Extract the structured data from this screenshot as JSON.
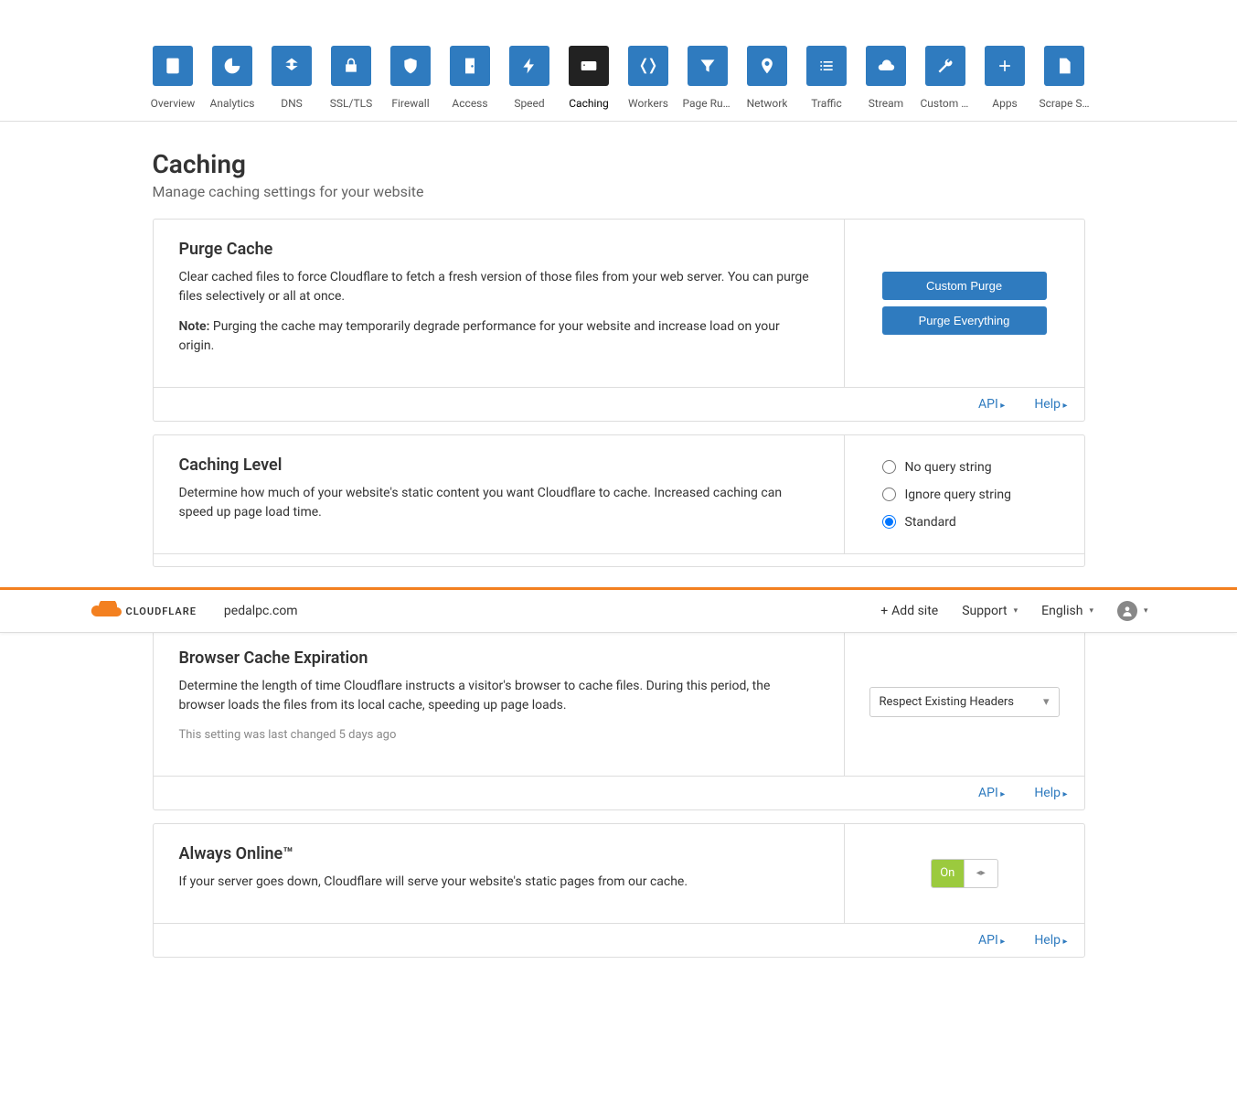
{
  "header": {
    "site_name": "pedalpc.com",
    "add_site": "Add site",
    "support": "Support",
    "language": "English",
    "logo_text": "CLOUDFLARE"
  },
  "nav": {
    "items": [
      {
        "label": "Overview"
      },
      {
        "label": "Analytics"
      },
      {
        "label": "DNS"
      },
      {
        "label": "SSL/TLS"
      },
      {
        "label": "Firewall"
      },
      {
        "label": "Access"
      },
      {
        "label": "Speed"
      },
      {
        "label": "Caching"
      },
      {
        "label": "Workers"
      },
      {
        "label": "Page Rules"
      },
      {
        "label": "Network"
      },
      {
        "label": "Traffic"
      },
      {
        "label": "Stream"
      },
      {
        "label": "Custom P…"
      },
      {
        "label": "Apps"
      },
      {
        "label": "Scrape S…"
      }
    ],
    "active_index": 7
  },
  "page": {
    "title": "Caching",
    "subtitle": "Manage caching settings for your website"
  },
  "cards": {
    "purge": {
      "title": "Purge Cache",
      "desc": "Clear cached files to force Cloudflare to fetch a fresh version of those files from your web server. You can purge files selectively or all at once.",
      "note_prefix": "Note:",
      "note_body": " Purging the cache may temporarily degrade performance for your website and increase load on your origin.",
      "btn_custom": "Custom Purge",
      "btn_everything": "Purge Everything"
    },
    "level": {
      "title": "Caching Level",
      "desc": "Determine how much of your website's static content you want Cloudflare to cache. Increased caching can speed up page load time.",
      "options": [
        "No query string",
        "Ignore query string",
        "Standard"
      ],
      "selected_index": 2
    },
    "browser": {
      "title": "Browser Cache Expiration",
      "desc": "Determine the length of time Cloudflare instructs a visitor's browser to cache files. During this period, the browser loads the files from its local cache, speeding up page loads.",
      "last_changed": "This setting was last changed 5 days ago",
      "select_value": "Respect Existing Headers"
    },
    "always": {
      "title": "Always Online™",
      "desc": "If your server goes down, Cloudflare will serve your website's static pages from our cache.",
      "toggle_on": "On"
    }
  },
  "footer_links": {
    "api": "API",
    "help": "Help"
  }
}
